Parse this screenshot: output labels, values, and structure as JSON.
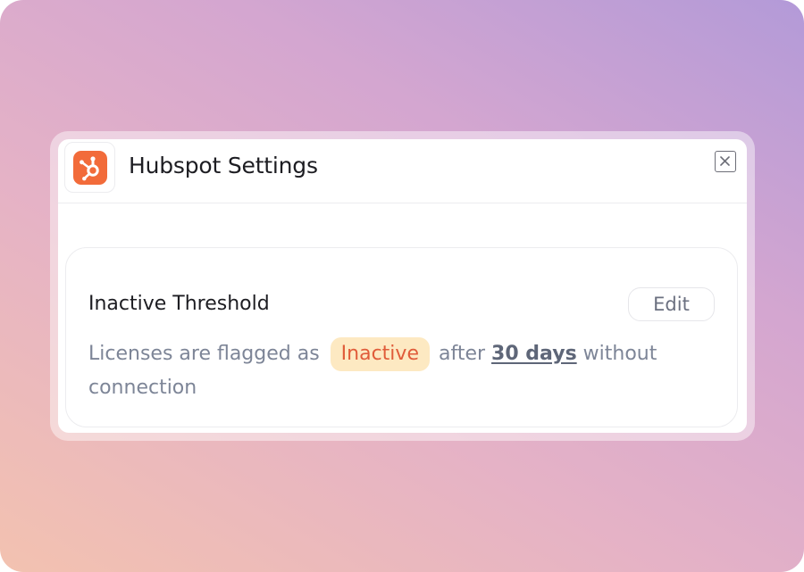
{
  "dialog": {
    "title": "Hubspot Settings",
    "app_icon": "hubspot-logo",
    "close_icon": "close-icon"
  },
  "threshold_card": {
    "title": "Inactive Threshold",
    "edit_label": "Edit",
    "description": {
      "prefix": "Licenses are flagged as",
      "status_badge": "Inactive",
      "middle": "after",
      "duration": "30 days",
      "suffix": "without connection"
    }
  },
  "colors": {
    "brand": "#f26b3a",
    "badge_background": "#fde9c2",
    "badge_text": "#e05c3a"
  }
}
